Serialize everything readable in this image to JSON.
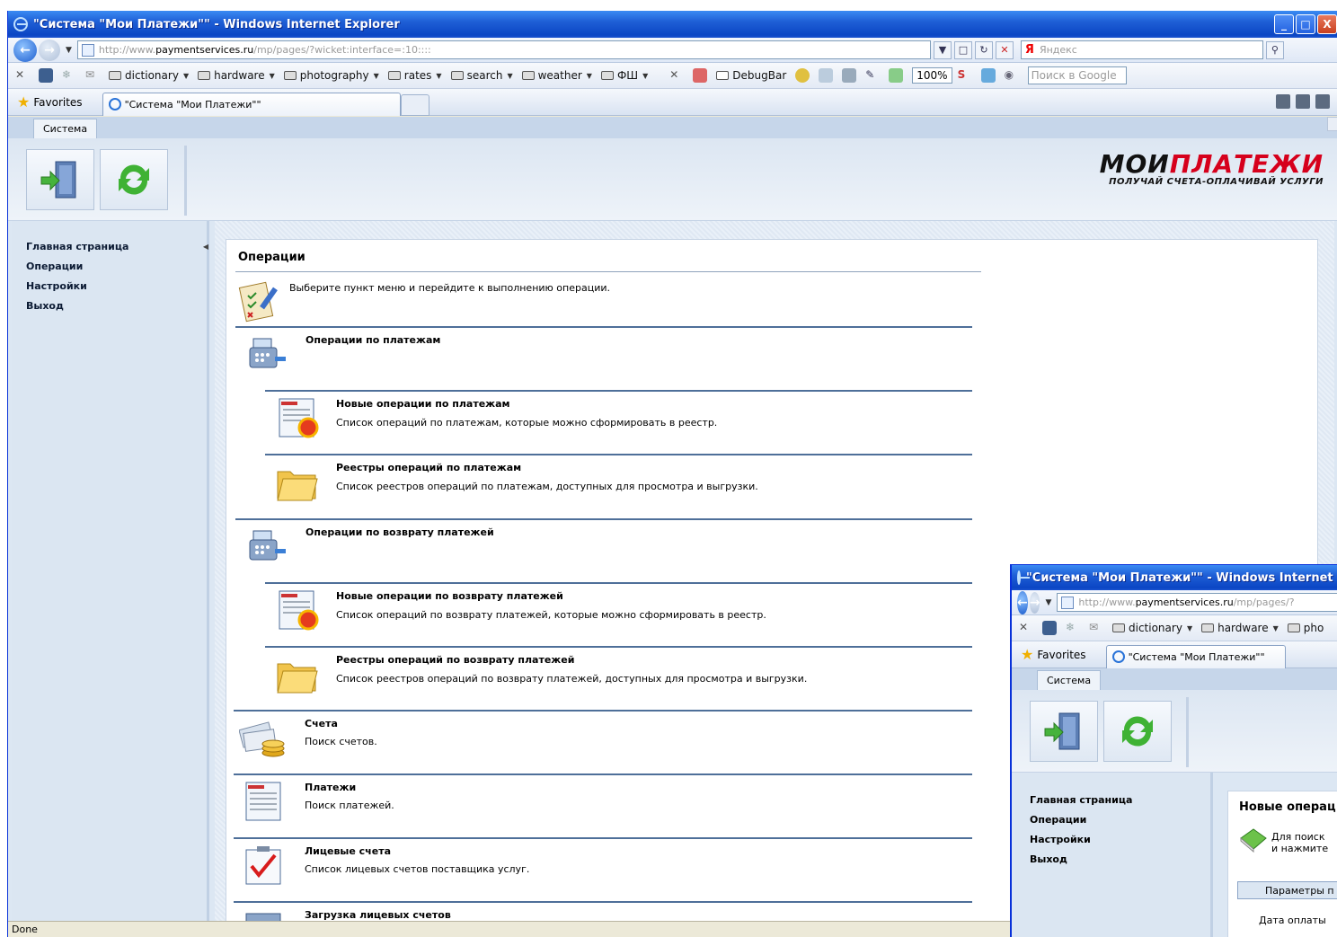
{
  "window": {
    "title": "\"Система \"Мои Платежи\"\" - Windows Internet Explorer",
    "min": "_",
    "max": "□",
    "close": "X"
  },
  "address": {
    "url_prefix": "http://www.",
    "url_domain": "paymentservices.ru",
    "url_path": "/mp/pages/?wicket:interface=:10::::",
    "search_engine": "Я",
    "search_placeholder": "Яндекс"
  },
  "links": [
    "dictionary",
    "hardware",
    "photography",
    "rates",
    "search",
    "weather",
    "ФШ"
  ],
  "toolbar_extra": {
    "debugbar": "DebugBar",
    "zoom": "100%",
    "google_placeholder": "Поиск в Google"
  },
  "tabs": {
    "favorites": "Favorites",
    "active_tab": "\"Система \"Мои Платежи\"\""
  },
  "page": {
    "system_tab": "Система",
    "logo": {
      "word1": "МОИ",
      "word2": "ПЛАТЕЖИ",
      "tagline": "ПОЛУЧАЙ СЧЕТА-ОПЛАЧИВАЙ УСЛУГИ"
    },
    "menu": [
      "Главная страница",
      "Операции",
      "Настройки",
      "Выход"
    ],
    "panel_title": "Операции",
    "intro": "Выберите пункт меню и перейдите к выполнению операции.",
    "items": [
      {
        "title": "Операции по платежам",
        "desc": ""
      },
      {
        "title": "Новые операции по платежам",
        "desc": "Список операций по платежам, которые можно сформировать в реестр."
      },
      {
        "title": "Реестры операций по платежам",
        "desc": "Список реестров операций по платежам, доступных для просмотра и выгрузки."
      },
      {
        "title": "Операции по возврату платежей",
        "desc": ""
      },
      {
        "title": "Новые операции по возврату платежей",
        "desc": "Список операций по возврату платежей, которые можно сформировать в реестр."
      },
      {
        "title": "Реестры операций по возврату платежей",
        "desc": "Список реестров операций по возврату платежей, доступных для просмотра и выгрузки."
      },
      {
        "title": "Счета",
        "desc": "Поиск счетов."
      },
      {
        "title": "Платежи",
        "desc": "Поиск платежей."
      },
      {
        "title": "Лицевые счета",
        "desc": "Список лицевых счетов поставщика услуг."
      },
      {
        "title": "Загрузка лицевых счетов",
        "desc": ""
      }
    ]
  },
  "status": "Done",
  "second_window": {
    "title": "\"Система \"Мои Платежи\"\" - Windows Internet E",
    "url_prefix": "http://www.",
    "url_domain": "paymentservices.ru",
    "url_path": "/mp/pages/?",
    "links": [
      "dictionary",
      "hardware",
      "pho"
    ],
    "favorites": "Favorites",
    "tab": "\"Система \"Мои Платежи\"\"",
    "system_tab": "Система",
    "menu": [
      "Главная страница",
      "Операции",
      "Настройки",
      "Выход"
    ],
    "panel_title": "Новые операц",
    "hint_line1": "Для поиск",
    "hint_line2": "и нажмите",
    "params": "Параметры п",
    "date_label": "Дата оплаты"
  }
}
